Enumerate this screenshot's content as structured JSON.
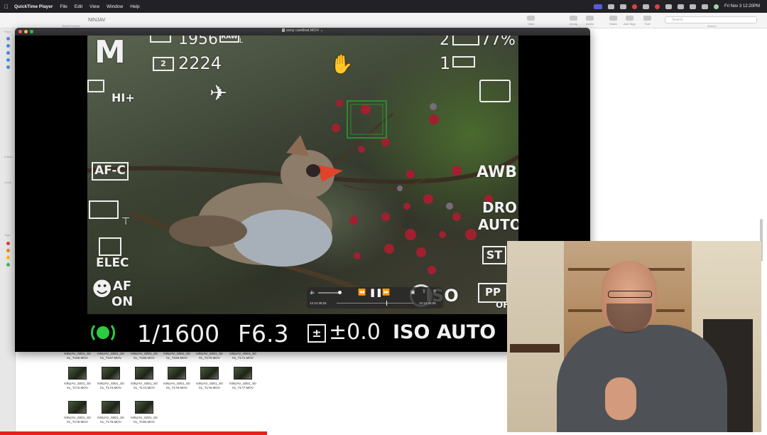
{
  "menubar": {
    "app_name": "QuickTime Player",
    "items": [
      "File",
      "Edit",
      "View",
      "Window",
      "Help"
    ],
    "clock": "Fri Nov 3  12:20PM"
  },
  "finder": {
    "title": "NINJAV",
    "back_forward": "Back/Forward",
    "toolbar": [
      "View",
      "Group",
      "Action",
      "Share",
      "Add Tags",
      "Sort"
    ],
    "search_placeholder": "Search",
    "search_label": "Search",
    "sidebar_labels": [
      "Favo",
      "iCloud",
      "Locat",
      "Tags"
    ],
    "files_row1": [
      "NINJAV_S001_S0\n01_T166.MOV",
      "NINJAV_S001_S0\n01_T167.MOV",
      "NINJAV_S001_S0\n01_T168.MOV",
      "NINJAV_S001_S0\n01_T169.MOV",
      "NINJAV_S001_S0\n01_T170.MOV",
      "NINJAV_S001_S0\n01_T171.MOV"
    ],
    "files_row2": [
      "NINJAV_S001_S0\n01_T172.MOV",
      "NINJAV_S001_S0\n01_T173.MOV",
      "NINJAV_S001_S0\n01_T174.MOV",
      "NINJAV_S001_S0\n01_T175.MOV",
      "NINJAV_S001_S0\n01_T176.MOV",
      "NINJAV_S001_S0\n01_T177.MOV"
    ],
    "files_row3": [
      "NINJAV_S001_S0\n01_T178.MOV",
      "NINJAV_S001_S0\n01_T179.MOV",
      "NINJAV_S001_S0\n01_T180.MOV"
    ]
  },
  "quicktime": {
    "window_title": "sony cardinal.MOV",
    "time_elapsed": "12:12:38;04",
    "time_remaining": "12:12:43;05",
    "progress": 0.65
  },
  "camera_overlay": {
    "mode": "M",
    "shots_remaining_1": "1956",
    "shots_remaining_2": "2224",
    "card_slot_2": "2",
    "raw": "RAW",
    "raw_sub": "L",
    "battery_1_slot": "2",
    "battery_1_pct": "77%",
    "battery_2_slot": "1",
    "drive_mode": "HI+",
    "focus_mode": "AF-C",
    "white_balance": "AWB",
    "dro": "DRO",
    "dro_value": "AUTO",
    "st": "ST",
    "elec": "ELEC",
    "face_af": "AF",
    "face_af_state": "ON",
    "iso_label": "ISO",
    "pp": "PP",
    "pp_value": "OF",
    "shutter": "1/1600",
    "aperture": "F6.3",
    "exposure_comp": "±0.0",
    "iso": "ISO AUTO"
  },
  "colors": {
    "menubar_bg": "#222226",
    "focus_box": "#2f8a2f",
    "rec_indicator": "#2ecc40",
    "youtube_progress": "#e4221b"
  }
}
